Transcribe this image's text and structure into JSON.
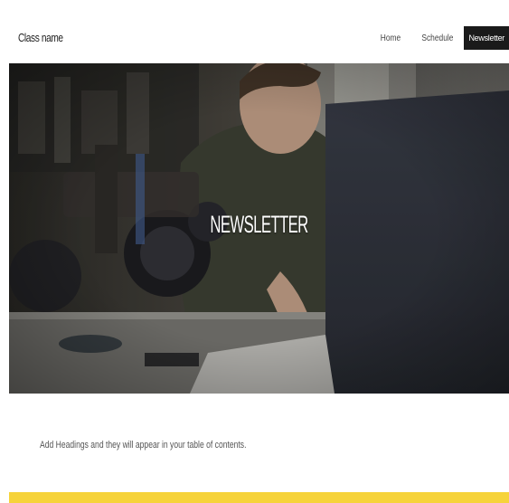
{
  "header": {
    "class_name": "Class name",
    "nav": [
      {
        "label": "Home",
        "active": false
      },
      {
        "label": "Schedule",
        "active": false
      },
      {
        "label": "Newsletter",
        "active": true
      }
    ]
  },
  "hero": {
    "title": "NEWSLETTER"
  },
  "content": {
    "toc_note": "Add Headings and they will appear in your table of contents."
  },
  "colors": {
    "footer_band": "#f6d33a",
    "active_nav_bg": "#1a1a1a"
  }
}
